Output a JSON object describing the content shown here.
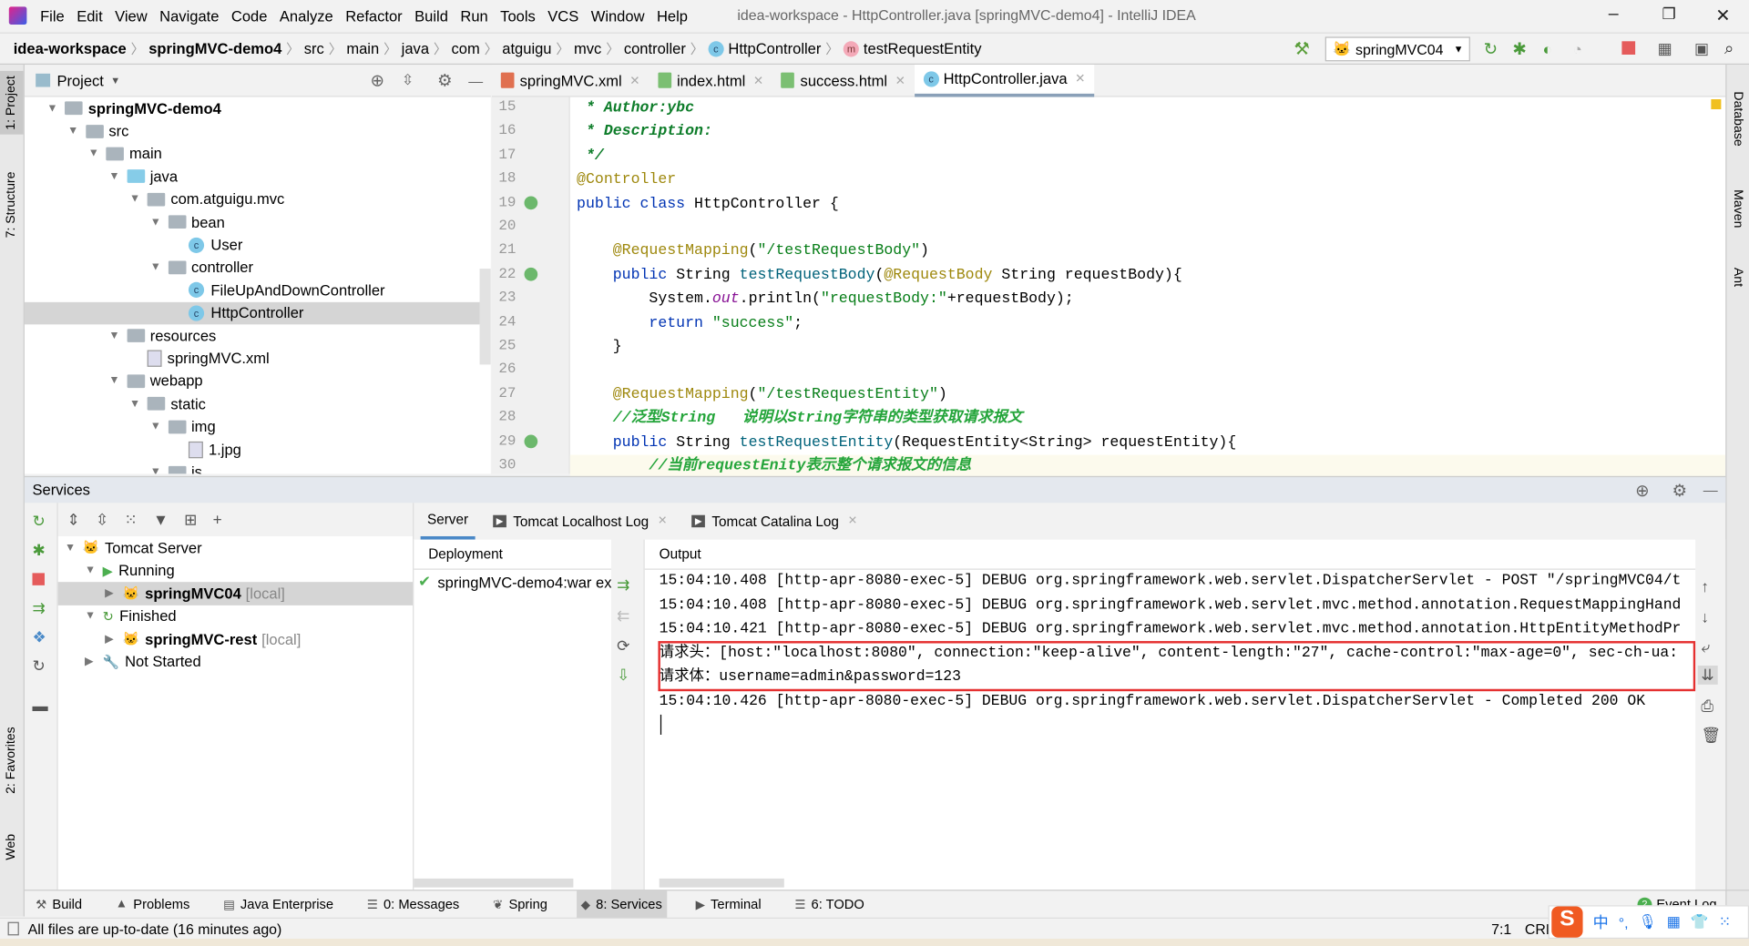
{
  "window": {
    "title": "idea-workspace - HttpController.java [springMVC-demo4] - IntelliJ IDEA",
    "minimize": "–",
    "restore": "❐",
    "close": "✕"
  },
  "menu": [
    "File",
    "Edit",
    "View",
    "Navigate",
    "Code",
    "Analyze",
    "Refactor",
    "Build",
    "Run",
    "Tools",
    "VCS",
    "Window",
    "Help"
  ],
  "breadcrumb": [
    {
      "t": "idea-workspace",
      "b": true
    },
    {
      "t": "springMVC-demo4",
      "b": true
    },
    {
      "t": "src"
    },
    {
      "t": "main"
    },
    {
      "t": "java"
    },
    {
      "t": "com"
    },
    {
      "t": "atguigu"
    },
    {
      "t": "mvc"
    },
    {
      "t": "controller"
    },
    {
      "t": "HttpController",
      "icon": "c"
    },
    {
      "t": "testRequestEntity",
      "icon": "m"
    }
  ],
  "run_config": "springMVC04",
  "left_strip": {
    "project": "1: Project",
    "structure": "7: Structure",
    "favorites": "2: Favorites",
    "web": "Web"
  },
  "right_strip": {
    "database": "Database",
    "maven": "Maven",
    "ant": "Ant"
  },
  "project_panel": {
    "title": "Project"
  },
  "tree": [
    {
      "d": 0,
      "l": "springMVC-demo4",
      "i": "module",
      "b": true,
      "open": true
    },
    {
      "d": 1,
      "l": "src",
      "i": "folder",
      "open": true
    },
    {
      "d": 2,
      "l": "main",
      "i": "folder",
      "open": true
    },
    {
      "d": 3,
      "l": "java",
      "i": "java",
      "open": true
    },
    {
      "d": 4,
      "l": "com.atguigu.mvc",
      "i": "package",
      "open": true
    },
    {
      "d": 5,
      "l": "bean",
      "i": "package",
      "open": true
    },
    {
      "d": 6,
      "l": "User",
      "i": "class"
    },
    {
      "d": 5,
      "l": "controller",
      "i": "package",
      "open": true
    },
    {
      "d": 6,
      "l": "FileUpAndDownController",
      "i": "class"
    },
    {
      "d": 6,
      "l": "HttpController",
      "i": "class",
      "sel": true
    },
    {
      "d": 3,
      "l": "resources",
      "i": "folder",
      "open": true
    },
    {
      "d": 4,
      "l": "springMVC.xml",
      "i": "file"
    },
    {
      "d": 3,
      "l": "webapp",
      "i": "folder",
      "open": true
    },
    {
      "d": 4,
      "l": "static",
      "i": "folder",
      "open": true
    },
    {
      "d": 5,
      "l": "img",
      "i": "folder",
      "open": true
    },
    {
      "d": 6,
      "l": "1.jpg",
      "i": "file"
    },
    {
      "d": 5,
      "l": "js",
      "i": "folder",
      "open": true
    }
  ],
  "tabs": [
    {
      "l": "springMVC.xml",
      "c": "#e07050"
    },
    {
      "l": "index.html",
      "c": "#7bbf72"
    },
    {
      "l": "success.html",
      "c": "#7bbf72"
    },
    {
      "l": "HttpController.java",
      "c": "class",
      "active": true
    }
  ],
  "code": [
    {
      "n": "15",
      "t": [
        [
          " * Author:ybc",
          "dc"
        ]
      ]
    },
    {
      "n": "16",
      "t": [
        [
          " * Description:",
          "dc"
        ]
      ]
    },
    {
      "n": "17",
      "t": [
        [
          " */",
          "dc"
        ]
      ]
    },
    {
      "n": "18",
      "t": [
        [
          "@Controller",
          "an"
        ]
      ]
    },
    {
      "n": "19",
      "t": [
        [
          "public class ",
          "k"
        ],
        [
          "HttpController {",
          ""
        ]
      ]
    },
    {
      "n": "20",
      "t": []
    },
    {
      "n": "21",
      "t": [
        [
          "    @RequestMapping",
          "an"
        ],
        [
          "(",
          ""
        ],
        [
          "\"/testRequestBody\"",
          "s"
        ],
        [
          ")",
          ""
        ]
      ]
    },
    {
      "n": "22",
      "t": [
        [
          "    public ",
          "k"
        ],
        [
          "String ",
          ""
        ],
        [
          "testRequestBody",
          "fn"
        ],
        [
          "(",
          ""
        ],
        [
          "@RequestBody",
          "an"
        ],
        [
          " String requestBody){",
          ""
        ]
      ]
    },
    {
      "n": "23",
      "t": [
        [
          "        System.",
          ""
        ],
        [
          "out",
          "st"
        ],
        [
          ".println(",
          ""
        ],
        [
          "\"requestBody:\"",
          "s"
        ],
        [
          "+requestBody);",
          ""
        ]
      ]
    },
    {
      "n": "24",
      "t": [
        [
          "        return ",
          "k"
        ],
        [
          "\"success\"",
          "s"
        ],
        [
          ";",
          ""
        ]
      ]
    },
    {
      "n": "25",
      "t": [
        [
          "    }",
          ""
        ]
      ]
    },
    {
      "n": "26",
      "t": []
    },
    {
      "n": "27",
      "t": [
        [
          "    @RequestMapping",
          "an"
        ],
        [
          "(",
          ""
        ],
        [
          "\"/testRequestEntity\"",
          "s"
        ],
        [
          ")",
          ""
        ]
      ]
    },
    {
      "n": "28",
      "t": [
        [
          "    //泛型String   说明以String字符串的类型获取请求报文",
          "cz"
        ]
      ]
    },
    {
      "n": "29",
      "t": [
        [
          "    public ",
          "k"
        ],
        [
          "String ",
          ""
        ],
        [
          "testRequestEntity",
          "fn"
        ],
        [
          "(RequestEntity<String> requestEntity){",
          ""
        ]
      ]
    },
    {
      "n": "30",
      "t": [
        [
          "        //当前requestEnity表示整个请求报文的信息",
          "cz"
        ]
      ]
    }
  ],
  "services": {
    "title": "Services",
    "tree": [
      {
        "d": 0,
        "l": "Tomcat Server",
        "open": true,
        "i": "tomcat"
      },
      {
        "d": 1,
        "l": "Running",
        "open": true,
        "i": "run"
      },
      {
        "d": 2,
        "l": "springMVC04",
        "suffix": "[local]",
        "b": true,
        "closed": true,
        "sel": true,
        "i": "tomcat"
      },
      {
        "d": 1,
        "l": "Finished",
        "open": true,
        "i": "finished"
      },
      {
        "d": 2,
        "l": "springMVC-rest",
        "suffix": "[local]",
        "b": true,
        "closed": true,
        "i": "tomcat"
      },
      {
        "d": 1,
        "l": "Not Started",
        "closed": true,
        "i": "wrench"
      }
    ],
    "tabs": [
      {
        "l": "Server",
        "active": true
      },
      {
        "l": "Tomcat Localhost Log",
        "close": true
      },
      {
        "l": "Tomcat Catalina Log",
        "close": true
      }
    ],
    "deployment_header": "Deployment",
    "deployment_item": "springMVC-demo4:war ex",
    "output_header": "Output",
    "output": [
      "15:04:10.408 [http-apr-8080-exec-5] DEBUG org.springframework.web.servlet.DispatcherServlet - POST \"/springMVC04/t",
      "15:04:10.408 [http-apr-8080-exec-5] DEBUG org.springframework.web.servlet.mvc.method.annotation.RequestMappingHand",
      "15:04:10.421 [http-apr-8080-exec-5] DEBUG org.springframework.web.servlet.mvc.method.annotation.HttpEntityMethodPr",
      "请求头：[host:\"localhost:8080\", connection:\"keep-alive\", content-length:\"27\", cache-control:\"max-age=0\", sec-ch-ua:",
      "请求体：username=admin&password=123",
      "15:04:10.426 [http-apr-8080-exec-5] DEBUG org.springframework.web.servlet.DispatcherServlet - Completed 200 OK"
    ],
    "highlight_color": "#e53030"
  },
  "bottom_tools": [
    {
      "l": "Build",
      "i": "⚒"
    },
    {
      "l": "Problems",
      "i": "▲"
    },
    {
      "l": "Java Enterprise",
      "i": "▤"
    },
    {
      "l": "0: Messages",
      "i": "☰"
    },
    {
      "l": "Spring",
      "i": "❦"
    },
    {
      "l": "8: Services",
      "i": "◆",
      "active": true
    },
    {
      "l": "Terminal",
      "i": "▶"
    },
    {
      "l": "6: TODO",
      "i": "☰"
    }
  ],
  "event_log": {
    "count": "2",
    "label": "Event Log"
  },
  "status": {
    "message": "All files are up-to-date (16 minutes ago)",
    "position": "7:1",
    "line_sep": "CRL"
  },
  "ime": {
    "logo": "S",
    "lang": "中"
  }
}
